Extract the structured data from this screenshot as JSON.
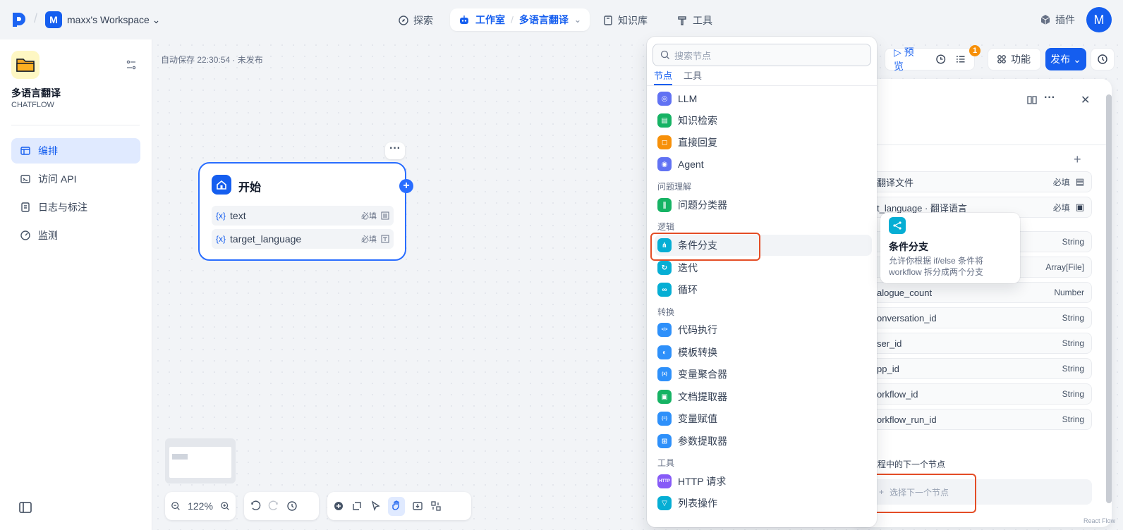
{
  "header": {
    "workspace_badge": "M",
    "workspace_name": "maxx's Workspace",
    "nav_explore": "探索",
    "nav_studio": "工作室",
    "nav_app": "多语言翻译",
    "nav_knowledge": "知识库",
    "nav_tools": "工具",
    "plugins": "插件",
    "avatar": "M"
  },
  "sidebar": {
    "app_name": "多语言翻译",
    "app_type": "CHATFLOW",
    "items": [
      {
        "label": "编排",
        "icon": "layout-icon"
      },
      {
        "label": "访问 API",
        "icon": "terminal-icon"
      },
      {
        "label": "日志与标注",
        "icon": "file-list-icon"
      },
      {
        "label": "监测",
        "icon": "dashboard-icon"
      }
    ]
  },
  "canvas": {
    "autosave": "自动保存 22:30:54 · 未发布",
    "start_node": {
      "title": "开始",
      "vars": [
        {
          "x": "{x}",
          "name": "text",
          "req": "必填"
        },
        {
          "x": "{x}",
          "name": "target_language",
          "req": "必填"
        }
      ]
    },
    "zoom": "122%"
  },
  "actions": {
    "preview": "预览",
    "badge": "1",
    "features": "功能",
    "publish": "发布"
  },
  "panel": {
    "rows": [
      {
        "name": "翻译文件",
        "type": "必填"
      },
      {
        "name": "t_language · 翻译语言",
        "type": "必填"
      },
      {
        "name": "",
        "type": "String"
      },
      {
        "name": "",
        "type": "Array[File]"
      },
      {
        "name": "alogue_count",
        "type": "Number"
      },
      {
        "name": "onversation_id",
        "type": "String"
      },
      {
        "name": "ser_id",
        "type": "String"
      },
      {
        "name": "pp_id",
        "type": "String"
      },
      {
        "name": "orkflow_id",
        "type": "String"
      },
      {
        "name": "orkflow_run_id",
        "type": "String"
      }
    ],
    "next_label": "流程中的下一个节点",
    "next_btn": "选择下一个节点",
    "reactflow": "React Flow"
  },
  "dropdown": {
    "search_placeholder": "搜索节点",
    "tab_nodes": "节点",
    "tab_tools": "工具",
    "items": [
      {
        "label": "LLM",
        "color": "#6172f3",
        "sym": "◎"
      },
      {
        "label": "知识检索",
        "color": "#16b364",
        "sym": "▤"
      },
      {
        "label": "直接回复",
        "color": "#f79009",
        "sym": "◻"
      },
      {
        "label": "Agent",
        "color": "#6172f3",
        "sym": "◉"
      },
      {
        "cat": "问题理解"
      },
      {
        "label": "问题分类器",
        "color": "#16b364",
        "sym": "∥"
      },
      {
        "cat": "逻辑"
      },
      {
        "label": "条件分支",
        "color": "#06aed4",
        "sym": "⋔"
      },
      {
        "label": "迭代",
        "color": "#06aed4",
        "sym": "↻"
      },
      {
        "label": "循环",
        "color": "#06aed4",
        "sym": "∞"
      },
      {
        "cat": "转换"
      },
      {
        "label": "代码执行",
        "color": "#2e90fa",
        "sym": "</>"
      },
      {
        "label": "模板转换",
        "color": "#2e90fa",
        "sym": "◐"
      },
      {
        "label": "变量聚合器",
        "color": "#2e90fa",
        "sym": "{x}"
      },
      {
        "label": "文档提取器",
        "color": "#16b364",
        "sym": "▣"
      },
      {
        "label": "变量赋值",
        "color": "#2e90fa",
        "sym": "{=}"
      },
      {
        "label": "参数提取器",
        "color": "#2e90fa",
        "sym": "⊞"
      },
      {
        "cat": "工具"
      },
      {
        "label": "HTTP 请求",
        "color": "#875bf7",
        "sym": "HTTP"
      },
      {
        "label": "列表操作",
        "color": "#06aed4",
        "sym": "▽"
      }
    ]
  },
  "tooltip": {
    "title": "条件分支",
    "desc": "允许你根据 if/else 条件将 workflow 拆分成两个分支"
  }
}
